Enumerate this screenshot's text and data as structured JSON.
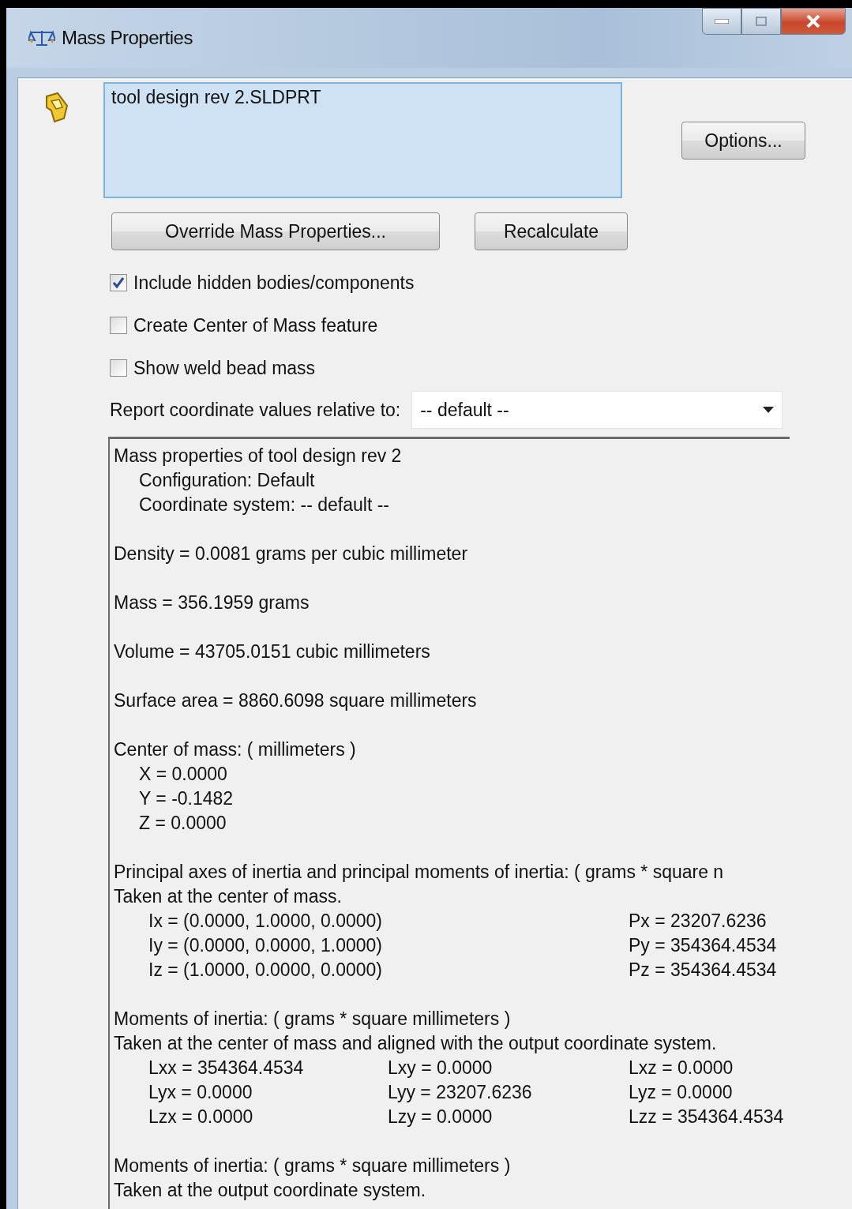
{
  "window": {
    "title": "Mass Properties"
  },
  "selection": {
    "value": "tool design rev 2.SLDPRT"
  },
  "buttons": [
    {
      "label": "Options..."
    },
    {
      "label": "Override Mass Properties..."
    },
    {
      "label": "Recalculate"
    }
  ],
  "checkboxes": [
    {
      "label": "Include hidden bodies/components",
      "checked": true
    },
    {
      "label": "Create Center of Mass feature",
      "checked": false
    },
    {
      "label": "Show weld bead mass",
      "checked": false
    }
  ],
  "coordinate_dropdown": {
    "label": "Report coordinate values relative to:",
    "value": "-- default --"
  },
  "report": [
    {
      "kind": "text",
      "lines": [
        {
          "text": "Mass properties of tool design rev 2",
          "children": [
            {
              "text": "Configuration: Default"
            },
            {
              "text": "Coordinate system: -- default --"
            }
          ]
        }
      ]
    },
    {
      "kind": "text",
      "lines": [
        {
          "text": "Density = 0.0081 grams per cubic millimeter"
        }
      ]
    },
    {
      "kind": "text",
      "lines": [
        {
          "text": "Mass = 356.1959 grams"
        }
      ]
    },
    {
      "kind": "text",
      "lines": [
        {
          "text": "Volume = 43705.0151 cubic millimeters"
        }
      ]
    },
    {
      "kind": "text",
      "lines": [
        {
          "text": "Surface area = 8860.6098  square millimeters"
        }
      ]
    },
    {
      "kind": "text",
      "lines": [
        {
          "text": "Center of mass: ( millimeters )",
          "children": [
            {
              "text": "X = 0.0000"
            },
            {
              "text": "Y = -0.1482"
            },
            {
              "text": "Z = 0.0000"
            }
          ]
        }
      ]
    },
    {
      "kind": "axes",
      "lines": [
        {
          "text": "Principal axes of inertia and principal moments of inertia: ( grams *  square n"
        },
        {
          "text": "Taken at the center of mass."
        }
      ],
      "rows": [
        {
          "axis": "Ix = (0.0000, 1.0000, 0.0000)",
          "moment": "Px = 23207.6236"
        },
        {
          "axis": "Iy = (0.0000, 0.0000, 1.0000)",
          "moment": "Py = 354364.4534"
        },
        {
          "axis": "Iz = (1.0000, 0.0000, 0.0000)",
          "moment": "Pz = 354364.4534"
        }
      ]
    },
    {
      "kind": "matrix",
      "lines": [
        {
          "text": "Moments of inertia: ( grams *  square millimeters )"
        },
        {
          "text": "Taken at the center of mass and aligned with the output coordinate system."
        }
      ],
      "rows": [
        [
          "Lxx = 354364.4534",
          "Lxy = 0.0000",
          "Lxz = 0.0000"
        ],
        [
          "Lyx = 0.0000",
          "Lyy = 23207.6236",
          "Lyz = 0.0000"
        ],
        [
          "Lzx = 0.0000",
          "Lzy = 0.0000",
          "Lzz = 354364.4534"
        ]
      ]
    },
    {
      "kind": "text",
      "lines": [
        {
          "text": "Moments of inertia: ( grams *  square millimeters )"
        },
        {
          "text": "Taken at the output coordinate system."
        }
      ]
    }
  ]
}
